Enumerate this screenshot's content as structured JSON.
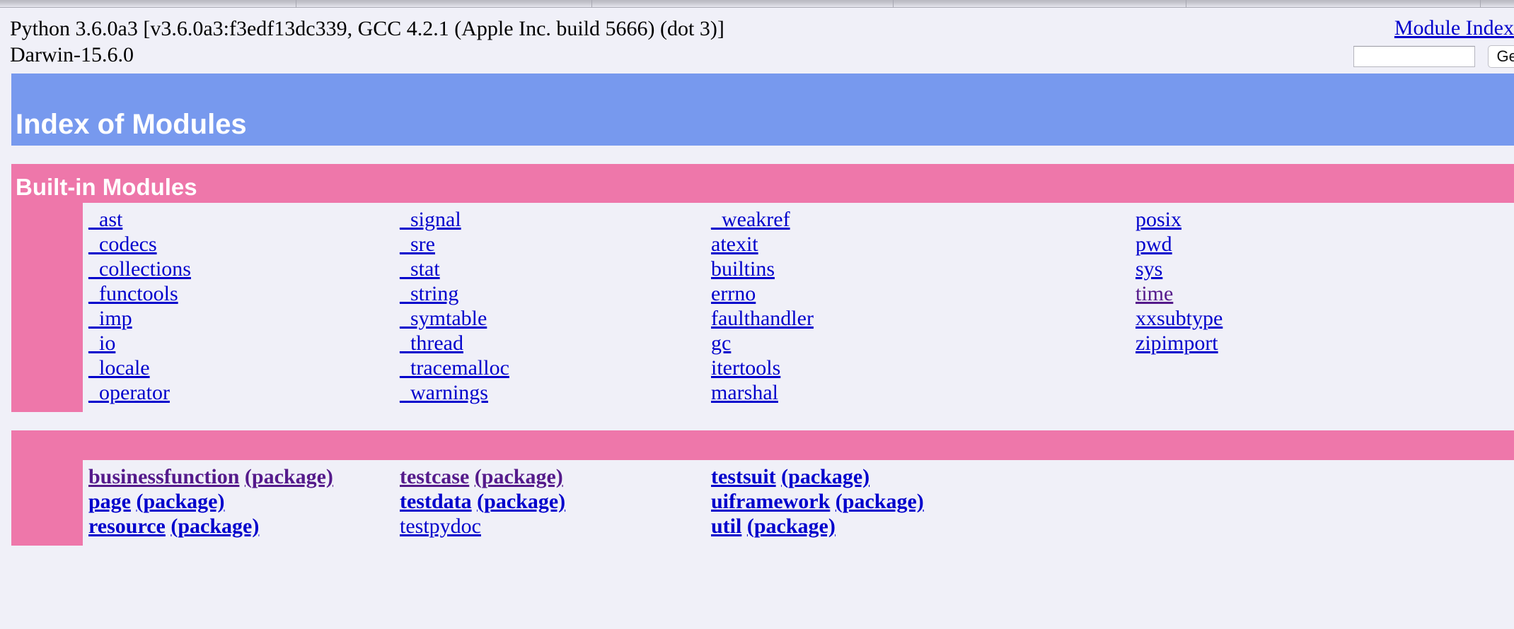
{
  "browser": {
    "tab_dividers": [
      418,
      836,
      1262,
      1676,
      2092
    ]
  },
  "header": {
    "version_line_1": "Python 3.6.0a3 [v3.6.0a3:f3edf13dc339, GCC 4.2.1 (Apple Inc. build 5666) (dot 3)]",
    "version_line_2": "Darwin-15.6.0",
    "module_index_link": "Module Index",
    "search_value": "",
    "search_placeholder": "",
    "search_button_label": "Get"
  },
  "title_banner": {
    "text": "Index of Modules"
  },
  "sections": [
    {
      "title": "Built-in Modules",
      "columns": [
        {
          "entries": [
            {
              "name": "_ast",
              "package": false,
              "visited": false
            },
            {
              "name": "_codecs",
              "package": false,
              "visited": false
            },
            {
              "name": "_collections",
              "package": false,
              "visited": false
            },
            {
              "name": "_functools",
              "package": false,
              "visited": false
            },
            {
              "name": "_imp",
              "package": false,
              "visited": false
            },
            {
              "name": "_io",
              "package": false,
              "visited": false
            },
            {
              "name": "_locale",
              "package": false,
              "visited": false
            },
            {
              "name": "_operator",
              "package": false,
              "visited": false
            }
          ]
        },
        {
          "entries": [
            {
              "name": "_signal",
              "package": false,
              "visited": false
            },
            {
              "name": "_sre",
              "package": false,
              "visited": false
            },
            {
              "name": "_stat",
              "package": false,
              "visited": false
            },
            {
              "name": "_string",
              "package": false,
              "visited": false
            },
            {
              "name": "_symtable",
              "package": false,
              "visited": false
            },
            {
              "name": "_thread",
              "package": false,
              "visited": false
            },
            {
              "name": "_tracemalloc",
              "package": false,
              "visited": false
            },
            {
              "name": "_warnings",
              "package": false,
              "visited": false
            }
          ]
        },
        {
          "entries": [
            {
              "name": "_weakref",
              "package": false,
              "visited": false
            },
            {
              "name": "atexit",
              "package": false,
              "visited": false
            },
            {
              "name": "builtins",
              "package": false,
              "visited": false
            },
            {
              "name": "errno",
              "package": false,
              "visited": false
            },
            {
              "name": "faulthandler",
              "package": false,
              "visited": false
            },
            {
              "name": "gc",
              "package": false,
              "visited": false
            },
            {
              "name": "itertools",
              "package": false,
              "visited": false
            },
            {
              "name": "marshal",
              "package": false,
              "visited": false
            }
          ]
        },
        {
          "entries": [
            {
              "name": "posix",
              "package": false,
              "visited": false
            },
            {
              "name": "pwd",
              "package": false,
              "visited": false
            },
            {
              "name": "sys",
              "package": false,
              "visited": false
            },
            {
              "name": "time",
              "package": false,
              "visited": true
            },
            {
              "name": "xxsubtype",
              "package": false,
              "visited": false
            },
            {
              "name": "zipimport",
              "package": false,
              "visited": false
            }
          ]
        }
      ]
    },
    {
      "title": "",
      "columns": [
        {
          "entries": [
            {
              "name": "businessfunction",
              "package": true,
              "visited": true,
              "suffix": "(package)"
            },
            {
              "name": "page",
              "package": true,
              "visited": false,
              "suffix": "(package)"
            },
            {
              "name": "resource",
              "package": true,
              "visited": false,
              "suffix": "(package)"
            }
          ]
        },
        {
          "entries": [
            {
              "name": "testcase",
              "package": true,
              "visited": true,
              "suffix": "(package)"
            },
            {
              "name": "testdata",
              "package": true,
              "visited": false,
              "suffix": "(package)"
            },
            {
              "name": "testpydoc",
              "package": false,
              "visited": false
            }
          ]
        },
        {
          "entries": [
            {
              "name": "testsuit",
              "package": true,
              "visited": false,
              "suffix": "(package)"
            },
            {
              "name": "uiframework",
              "package": true,
              "visited": false,
              "suffix": "(package)"
            },
            {
              "name": "util",
              "package": true,
              "visited": false,
              "suffix": "(package)"
            }
          ]
        },
        {
          "entries": []
        }
      ]
    }
  ],
  "colors": {
    "banner_blue": "#7799ee",
    "section_pink": "#ee77aa",
    "page_background": "#f0f0f8",
    "link": "#0000cc",
    "link_visited": "#551a8b"
  }
}
